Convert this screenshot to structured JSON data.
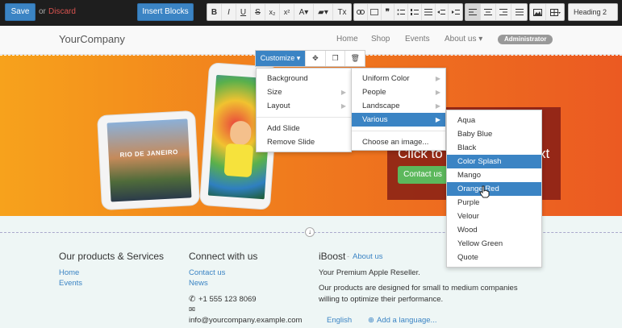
{
  "toolbar": {
    "save_label": "Save",
    "or_label": "or",
    "discard_label": "Discard",
    "insert_blocks_label": "Insert Blocks",
    "format_buttons": [
      "B",
      "I",
      "U",
      "S",
      "x₂",
      "x²",
      "A▾",
      "▰▾",
      "Tx"
    ],
    "heading_select": "Heading 2"
  },
  "site": {
    "logo": "YourCompany",
    "nav": [
      "Home",
      "Shop",
      "Events",
      "About us ▾"
    ],
    "admin": "Administrator"
  },
  "hero": {
    "tablet_text": "RIO DE JANEIRO",
    "title": "Click to c",
    "title_tail": "xt",
    "cta": "Contact us"
  },
  "customize": {
    "button": "Customize ▾",
    "menu1": [
      "Background",
      "Size",
      "Layout",
      "Add Slide",
      "Remove Slide"
    ],
    "menu2": [
      "Uniform Color",
      "People",
      "Landscape",
      "Various",
      "Choose an image..."
    ],
    "menu3": [
      "Aqua",
      "Baby Blue",
      "Black",
      "Color Splash",
      "Mango",
      "Orange Red",
      "Purple",
      "Velour",
      "Wood",
      "Yellow Green",
      "Quote"
    ]
  },
  "footer": {
    "col1_title": "Our products & Services",
    "col1_links": [
      "Home",
      "Events"
    ],
    "col2_title": "Connect with us",
    "col2_links": [
      "Contact us",
      "News"
    ],
    "phone": "+1 555 123 8069",
    "email": "info@yourcompany.example.com",
    "col3_title": "iBoost",
    "col3_link": "About us",
    "col3_tagline": "Your Premium Apple Reseller.",
    "col3_desc1": "Our products are designed for small to medium companies",
    "col3_desc2": "willing to optimize their performance.",
    "lang": "English",
    "add_lang": "Add a language..."
  }
}
